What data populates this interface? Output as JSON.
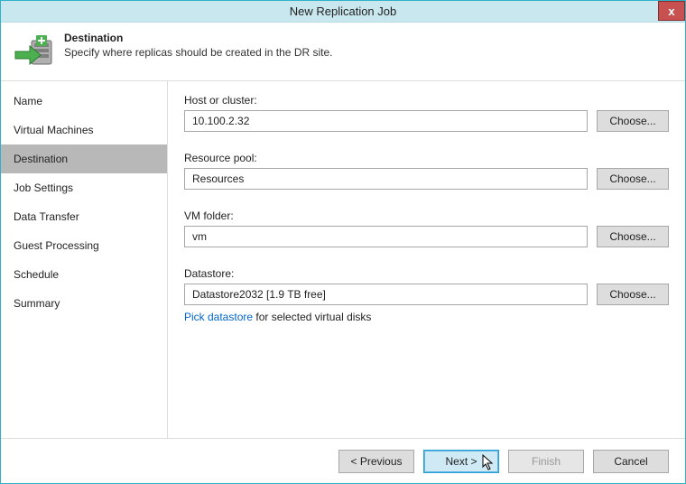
{
  "window": {
    "title": "New Replication Job",
    "close": "x"
  },
  "header": {
    "title": "Destination",
    "subtitle": "Specify where replicas should be created in the DR site."
  },
  "sidebar": {
    "items": [
      {
        "label": "Name",
        "selected": false
      },
      {
        "label": "Virtual Machines",
        "selected": false
      },
      {
        "label": "Destination",
        "selected": true
      },
      {
        "label": "Job Settings",
        "selected": false
      },
      {
        "label": "Data Transfer",
        "selected": false
      },
      {
        "label": "Guest Processing",
        "selected": false
      },
      {
        "label": "Schedule",
        "selected": false
      },
      {
        "label": "Summary",
        "selected": false
      }
    ]
  },
  "fields": {
    "host": {
      "label": "Host or cluster:",
      "value": "10.100.2.32",
      "button": "Choose..."
    },
    "pool": {
      "label": "Resource pool:",
      "value": "Resources",
      "button": "Choose..."
    },
    "folder": {
      "label": "VM folder:",
      "value": "vm",
      "button": "Choose..."
    },
    "datastore": {
      "label": "Datastore:",
      "value": "Datastore2032 [1.9 TB free]",
      "button": "Choose...",
      "pick_link": "Pick datastore",
      "pick_suffix": "  for selected virtual disks"
    }
  },
  "footer": {
    "previous": "< Previous",
    "next": "Next >",
    "finish": "Finish",
    "cancel": "Cancel"
  }
}
